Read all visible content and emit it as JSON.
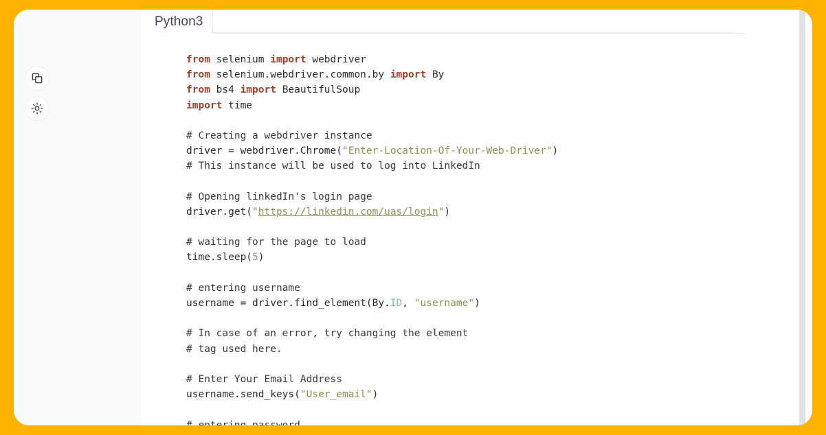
{
  "theme": {
    "frame_color": "#FFB300",
    "card_color": "#FFFFFF",
    "gutter_color": "#FAFAFA",
    "keyword_color": "#9C3F2E",
    "string_color": "#8F8F55",
    "comment_color": "#3A3A3A",
    "class_color": "#7EC699",
    "number_color": "#66A399",
    "tab_label_color": "#4B3F57"
  },
  "notebook": {
    "tabs": [
      {
        "label": "Python3",
        "active": true
      }
    ]
  },
  "cell_toolbar": {
    "buttons": [
      {
        "name": "copy-icon",
        "title": "Copy"
      },
      {
        "name": "brightness-icon",
        "title": "Toggle theme"
      }
    ]
  },
  "code": {
    "language": "Python3",
    "lines": [
      [
        {
          "t": "from ",
          "c": "kw"
        },
        {
          "t": "selenium ",
          "c": "plain"
        },
        {
          "t": "import ",
          "c": "kw"
        },
        {
          "t": "webdriver",
          "c": "plain"
        }
      ],
      [
        {
          "t": "from ",
          "c": "kw"
        },
        {
          "t": "selenium.webdriver.common.by ",
          "c": "plain"
        },
        {
          "t": "import ",
          "c": "kw"
        },
        {
          "t": "By",
          "c": "plain"
        }
      ],
      [
        {
          "t": "from ",
          "c": "kw"
        },
        {
          "t": "bs4 ",
          "c": "plain"
        },
        {
          "t": "import ",
          "c": "kw"
        },
        {
          "t": "BeautifulSoup",
          "c": "plain"
        }
      ],
      [
        {
          "t": "import ",
          "c": "kw"
        },
        {
          "t": "time",
          "c": "plain"
        }
      ],
      [],
      [
        {
          "t": "# Creating a webdriver instance",
          "c": "cmt"
        }
      ],
      [
        {
          "t": "driver = webdriver.Chrome(",
          "c": "plain"
        },
        {
          "t": "\"Enter-Location-Of-Your-Web-Driver\"",
          "c": "str"
        },
        {
          "t": ")",
          "c": "plain"
        }
      ],
      [
        {
          "t": "# This instance will be used to log into LinkedIn",
          "c": "cmt"
        }
      ],
      [],
      [
        {
          "t": "# Opening linkedIn's login page",
          "c": "cmt"
        }
      ],
      [
        {
          "t": "driver.get(",
          "c": "plain"
        },
        {
          "t": "\"",
          "c": "str"
        },
        {
          "t": "https://linkedin.com/uas/login",
          "c": "url"
        },
        {
          "t": "\"",
          "c": "str"
        },
        {
          "t": ")",
          "c": "plain"
        }
      ],
      [],
      [
        {
          "t": "# waiting for the page to load",
          "c": "cmt"
        }
      ],
      [
        {
          "t": "time.sleep(",
          "c": "plain"
        },
        {
          "t": "5",
          "c": "num"
        },
        {
          "t": ")",
          "c": "plain"
        }
      ],
      [],
      [
        {
          "t": "# entering username",
          "c": "cmt"
        }
      ],
      [
        {
          "t": "username = driver.find_element(By.",
          "c": "plain"
        },
        {
          "t": "ID",
          "c": "cls"
        },
        {
          "t": ", ",
          "c": "plain"
        },
        {
          "t": "\"username\"",
          "c": "str"
        },
        {
          "t": ")",
          "c": "plain"
        }
      ],
      [],
      [
        {
          "t": "# In case of an error, try changing the element",
          "c": "cmt"
        }
      ],
      [
        {
          "t": "# tag used here.",
          "c": "cmt"
        }
      ],
      [],
      [
        {
          "t": "# Enter Your Email Address",
          "c": "cmt"
        }
      ],
      [
        {
          "t": "username.send_keys(",
          "c": "plain"
        },
        {
          "t": "\"User_email\"",
          "c": "str"
        },
        {
          "t": ")",
          "c": "plain"
        }
      ],
      [],
      [
        {
          "t": "# entering password",
          "c": "cmt"
        }
      ]
    ]
  },
  "scrollbar": {
    "name": "vertical-scrollbar",
    "position_percent": 0
  }
}
